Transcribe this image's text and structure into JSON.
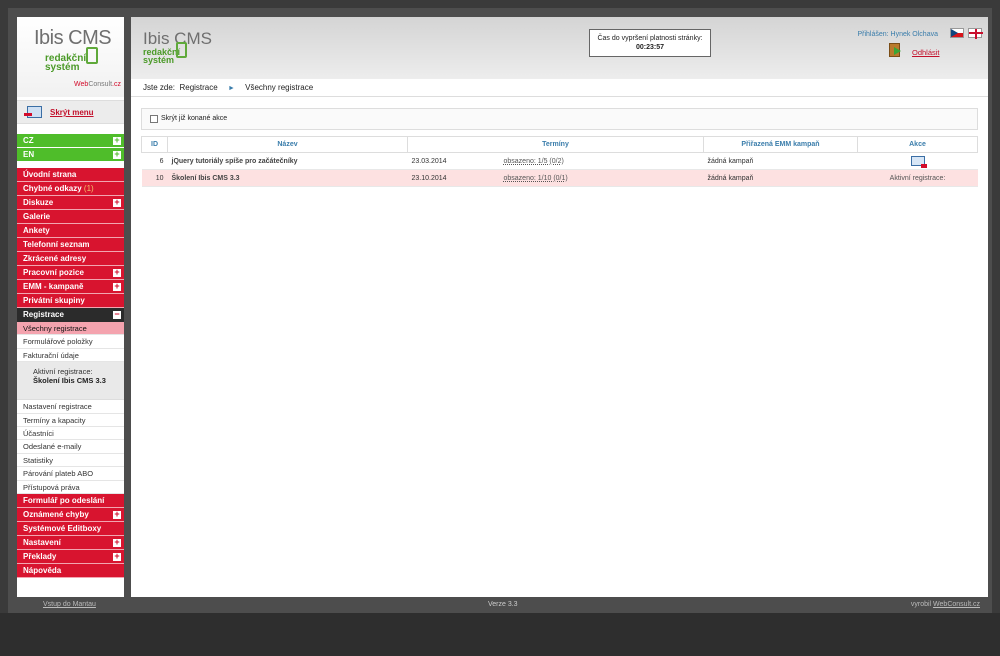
{
  "logo": {
    "name": "Ibis CMS",
    "line1": "redakční",
    "line2": "systém",
    "vendor_a": "Web",
    "vendor_b": "Consult",
    "vendor_c": ".cz"
  },
  "sidebar": {
    "hide_menu": "Skrýt menu",
    "languages": [
      "CZ",
      "EN"
    ],
    "menu_top": [
      {
        "label": "Úvodní strana",
        "plus": false
      },
      {
        "label": "Chybné odkazy",
        "count": "(1)",
        "plus": false
      },
      {
        "label": "Diskuze",
        "plus": true
      },
      {
        "label": "Galerie",
        "plus": false
      },
      {
        "label": "Ankety",
        "plus": false
      },
      {
        "label": "Telefonní seznam",
        "plus": false
      },
      {
        "label": "Zkrácené adresy",
        "plus": false
      },
      {
        "label": "Pracovní pozice",
        "plus": true
      },
      {
        "label": "EMM - kampaně",
        "plus": true
      },
      {
        "label": "Privátní skupiny",
        "plus": false
      }
    ],
    "registrace": "Registrace",
    "sub_top": [
      "Všechny registrace",
      "Formulářové položky",
      "Fakturační údaje"
    ],
    "active_label": "Aktivní registrace:",
    "active_name": "Školení Ibis CMS 3.3",
    "sub_bottom": [
      "Nastavení registrace",
      "Termíny a kapacity",
      "Účastníci",
      "Odeslané e-maily",
      "Statistiky",
      "Párování plateb ABO",
      "Přístupová práva"
    ],
    "menu_bottom": [
      {
        "label": "Formulář po odeslání",
        "plus": false
      },
      {
        "label": "Oznámené chyby",
        "plus": true
      },
      {
        "label": "Systémové Editboxy",
        "plus": false
      },
      {
        "label": "Nastavení",
        "plus": true
      },
      {
        "label": "Překlady",
        "plus": true
      },
      {
        "label": "Nápověda",
        "plus": false
      }
    ]
  },
  "header": {
    "timer_label": "Čas do vypršení platnosti stránky:",
    "timer_value": "00:23:57",
    "logged_in": "Přihlášen: Hynek Olchava",
    "logout": "Odhlásit"
  },
  "breadcrumb": {
    "prefix": "Jste zde:",
    "items": [
      "Registrace",
      "Všechny registrace"
    ]
  },
  "filter": {
    "label": "Skrýt již konané akce"
  },
  "table": {
    "headers": [
      "ID",
      "Název",
      "Termíny",
      "Přiřazená EMM kampaň",
      "Akce"
    ],
    "rows": [
      {
        "id": "6",
        "name": "jQuery tutoriály spíše pro začátečníky",
        "date": "23.03.2014",
        "occupied": "obsazeno: 1/5  (0/2)",
        "campaign": "žádná kampaň",
        "action": ""
      },
      {
        "id": "10",
        "name": "Školení Ibis CMS 3.3",
        "date": "23.10.2014",
        "occupied": "obsazeno: 1/10  (0/1)",
        "campaign": "žádná kampaň",
        "action": "Aktivní registrace:"
      }
    ]
  },
  "footer": {
    "left": "Vstup do Mantau",
    "center": "Verze 3.3",
    "right_prefix": "vyrobil ",
    "right_link": "WebConsult.cz"
  }
}
